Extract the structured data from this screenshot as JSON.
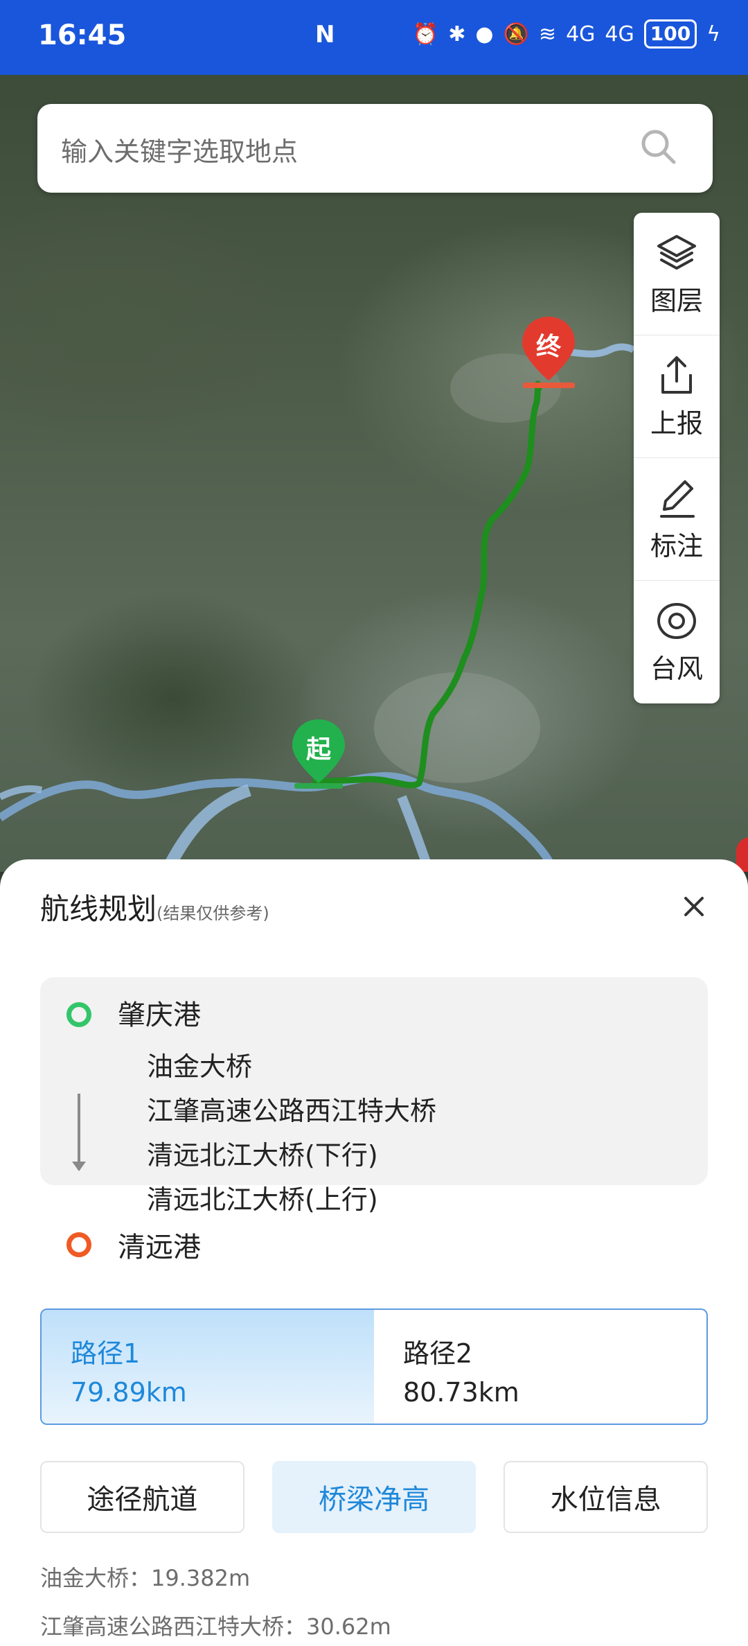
{
  "status_bar": {
    "time": "16:45",
    "nfc": "N",
    "network": "4G",
    "network2": "4G",
    "battery": "100"
  },
  "search": {
    "placeholder": "输入关键字选取地点"
  },
  "tools": [
    {
      "label": "图层",
      "icon": "layers-icon"
    },
    {
      "label": "上报",
      "icon": "share-upload-icon"
    },
    {
      "label": "标注",
      "icon": "pencil-icon"
    },
    {
      "label": "台风",
      "icon": "typhoon-icon"
    }
  ],
  "map": {
    "start_marker": "起",
    "end_marker": "终"
  },
  "route_planning": {
    "title": "航线规划",
    "subtitle": "(结果仅供参考)",
    "start": "肇庆港",
    "bridges": [
      "油金大桥",
      "江肇高速公路西江特大桥",
      "清远北江大桥(下行)",
      "清远北江大桥(上行)"
    ],
    "end": "清远港",
    "paths": [
      {
        "name": "路径1",
        "distance": "79.89km"
      },
      {
        "name": "路径2",
        "distance": "80.73km"
      }
    ],
    "tabs": [
      "途径航道",
      "桥梁净高",
      "水位信息"
    ],
    "info": [
      "油金大桥：19.382m",
      "江肇高速公路西江特大桥：30.62m"
    ]
  },
  "colors": {
    "status_bar": "#1a56db",
    "route_line": "#1e8e1e",
    "start_pin": "#22b14c",
    "end_pin": "#e23b2e",
    "accent": "#1e88d9"
  }
}
